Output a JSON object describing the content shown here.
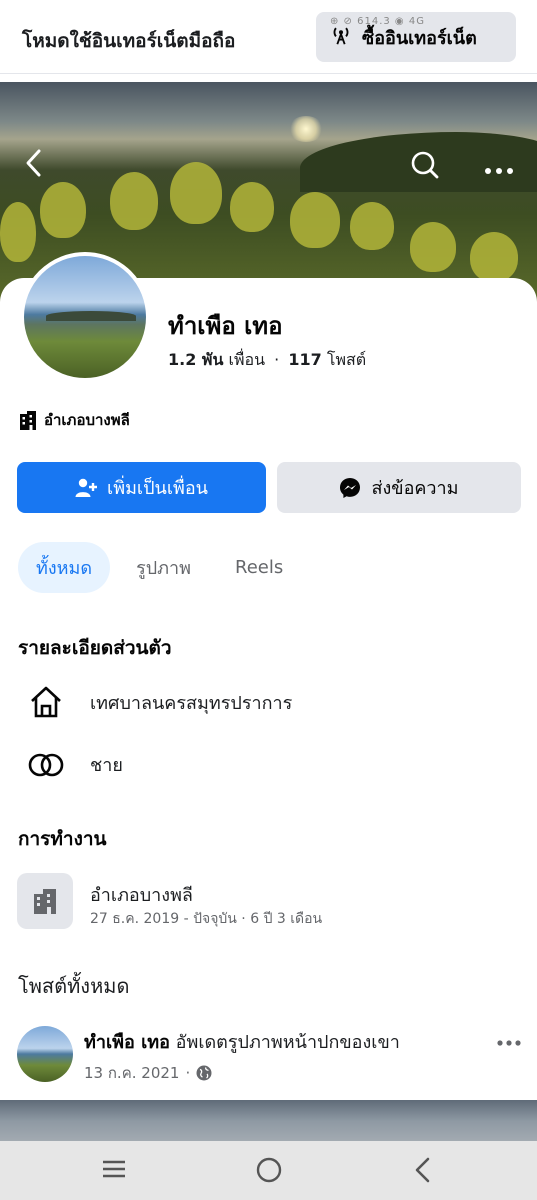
{
  "topbar": {
    "mode_text": "โหมดใช้อินเทอร์เน็ตมือถือ",
    "buy_button": "ซื้ออินเทอร์เน็ต",
    "status_overlay": "⊕ ⊘ 614.3 ◉ 4G"
  },
  "cover": {
    "back_icon": "chevron-left-icon",
    "search_icon": "search-icon",
    "more_icon": "more-horizontal-icon"
  },
  "profile": {
    "name": "ทำเพือ เทอ",
    "friends_count": "1.2 พัน",
    "friends_label": "เพื่อน",
    "separator": "·",
    "posts_count": "117",
    "posts_label": "โพสต์",
    "location": "อำเภอบางพลี"
  },
  "actions": {
    "add_friend": "เพิ่มเป็นเพื่อน",
    "message": "ส่งข้อความ"
  },
  "tabs": [
    {
      "label": "ทั้งหมด",
      "active": true
    },
    {
      "label": "รูปภาพ",
      "active": false
    },
    {
      "label": "Reels",
      "active": false
    }
  ],
  "details": {
    "title": "รายละเอียดส่วนตัว",
    "items": [
      {
        "icon": "home-icon",
        "text": "เทศบาลนครสมุทรปราการ"
      },
      {
        "icon": "relationship-rings-icon",
        "text": "ชาย"
      }
    ]
  },
  "work": {
    "title": "การทำงาน",
    "name": "อำเภอบางพลี",
    "period": "27 ธ.ค. 2019 - ปัจจุบัน · 6 ปี 3 เดือน"
  },
  "posts": {
    "title": "โพสต์ทั้งหมด",
    "first": {
      "author": "ทำเพือ เทอ",
      "action": "อัพเดตรูปภาพหน้าปกของเขา",
      "date": "13 ก.ค. 2021",
      "separator": "·",
      "privacy_icon": "globe-icon",
      "more_icon": "more-horizontal-icon"
    }
  },
  "system_nav": {
    "recent_icon": "recent-apps-icon",
    "home_icon": "home-circle-icon",
    "back_icon": "back-chevron-icon"
  },
  "colors": {
    "primary": "#1877f2",
    "secondary_bg": "#e4e6eb",
    "tab_active_bg": "#e7f3ff",
    "muted_text": "#65676b"
  }
}
